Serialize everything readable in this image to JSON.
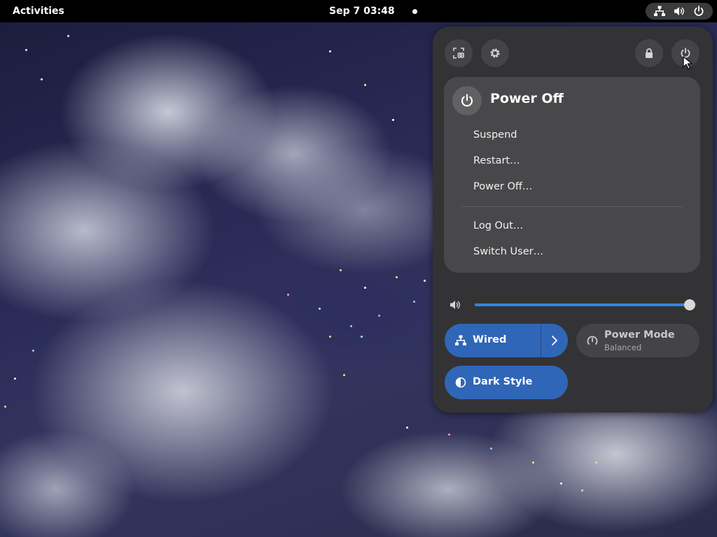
{
  "topbar": {
    "activities_label": "Activities",
    "clock_label": "Sep 7  03:48",
    "tray_icons": [
      "network-wired-icon",
      "volume-icon",
      "power-icon"
    ]
  },
  "quick_settings": {
    "header_buttons": [
      "screenshot-icon",
      "settings-gear-icon",
      "lock-icon",
      "power-icon"
    ],
    "power_menu": {
      "title": "Power Off",
      "items": [
        "Suspend",
        "Restart…",
        "Power Off…"
      ],
      "session_items": [
        "Log Out…",
        "Switch User…"
      ]
    },
    "volume": {
      "level_percent": 100
    },
    "toggles": {
      "wired": {
        "label": "Wired",
        "active": true
      },
      "power_mode": {
        "label": "Power Mode",
        "subtitle": "Balanced",
        "active": false
      },
      "dark_style": {
        "label": "Dark Style",
        "active": true
      }
    }
  },
  "colors": {
    "accent": "#3066b7",
    "slider_fill": "#3584e4",
    "panel_bg": "#333335",
    "submenu_bg": "#48484a",
    "topbar_bg": "#000000"
  }
}
